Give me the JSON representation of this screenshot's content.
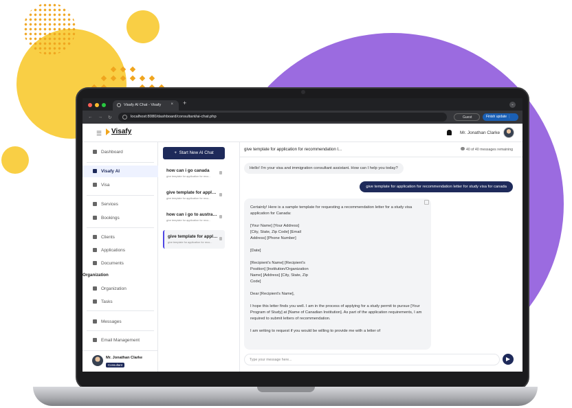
{
  "browser": {
    "tab_title": "Visafy AI Chat - Visafy",
    "tab_close": "×",
    "new_tab": "+",
    "url": "localhost:8080/dashboard/consultant/ai-chat.php",
    "guest_label": "Guest",
    "finish_update_label": "Finish update"
  },
  "app": {
    "logo_text": "Visafy",
    "user_name": "Mr. Jonathan Clarke"
  },
  "sidebar": {
    "items": [
      {
        "label": "Dashboard"
      },
      {
        "label": "Visafy AI"
      },
      {
        "label": "Visa"
      },
      {
        "label": "Services"
      },
      {
        "label": "Bookings"
      },
      {
        "label": "Clients"
      },
      {
        "label": "Applications"
      },
      {
        "label": "Documents"
      },
      {
        "label": "Organization"
      },
      {
        "label": "Tasks"
      },
      {
        "label": "Messages"
      },
      {
        "label": "Email Management"
      }
    ],
    "section_organization": "Organization",
    "profile_name": "Mr. Jonathan Clarke",
    "profile_role": "Consultant"
  },
  "chat_list": {
    "new_chat_label": "Start New AI Chat",
    "chats": [
      {
        "title": "how can i go canada",
        "subtitle": "give template for application for reco..."
      },
      {
        "title": "give template for applicatio...",
        "subtitle": "give template for application for reco..."
      },
      {
        "title": "how can i go to australia",
        "subtitle": "give template for application for reco..."
      },
      {
        "title": "give template for applicati...",
        "subtitle": "give template for application for reco..."
      }
    ]
  },
  "chat": {
    "title": "give template for application for recommendation l...",
    "remaining": "40 of 40 messages remaining",
    "greeting": "Hello! I'm your visa and immigration consultant assistant. How can I help you today?",
    "user_message": "give template for application for recommendation letter for study visa for canada",
    "response_paragraphs": [
      "Certainly! Here is a sample template for requesting a recommendation letter for a study visa application for Canada:",
      "[Your Name] [Your Address] [City, State, Zip Code] [Email Address] [Phone Number]",
      "[Date]",
      "[Recipient's Name] [Recipient's Position] [Institution/Organization Name] [Address] [City, State, Zip Code]",
      "Dear [Recipient's Name],",
      "I hope this letter finds you well. I am in the process of applying for a study permit to pursue [Your Program of Study] at [Name of Canadian Institution]. As part of the application requirements, I am required to submit letters of recommendation.",
      "I am writing to request if you would be willing to provide me with a letter of"
    ],
    "input_placeholder": "Type your message here..."
  }
}
